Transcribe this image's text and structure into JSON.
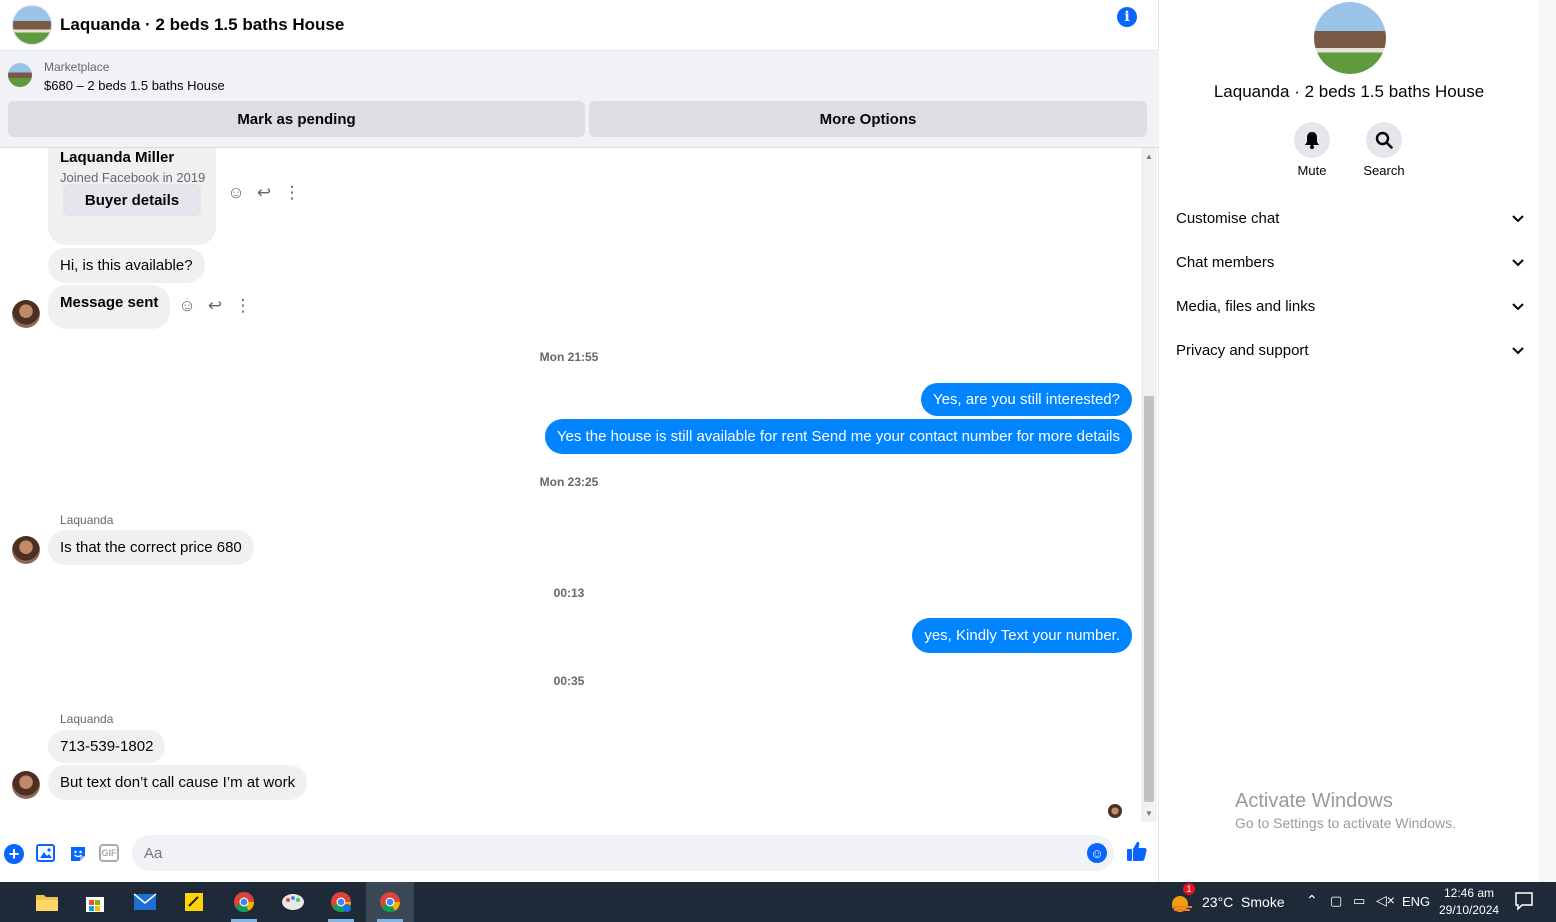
{
  "header": {
    "title": "Laquanda · 2 beds 1.5 baths House",
    "info_icon": "i"
  },
  "marketplace": {
    "label": "Marketplace",
    "item": "$680 – 2 beds 1.5 baths House",
    "mark_pending": "Mark as pending",
    "more_options": "More Options"
  },
  "card": {
    "name": "Laquanda Miller",
    "sub": "Joined Facebook in 2019",
    "button": "Buyer details"
  },
  "messages": {
    "m1": "Hi, is this available?",
    "m2": "Message sent",
    "t1": "Mon 21:55",
    "m3": "Yes, are you still interested?",
    "m4": "Yes the house is still available for rent Send me your contact number for more details",
    "t2": "Mon 23:25",
    "sender": "Laquanda",
    "m5": "Is that the correct price 680",
    "t3": "00:13",
    "m6": "yes, Kindly Text your number.",
    "t4": "00:35",
    "m7": "713-539-1802",
    "m8": "But text don’t call cause I’m at work"
  },
  "composer": {
    "placeholder": "Aa",
    "gif": "GIF"
  },
  "panel": {
    "title": "Laquanda · 2 beds 1.5 baths House",
    "mute": "Mute",
    "search": "Search",
    "sections": [
      "Customise chat",
      "Chat members",
      "Media, files and links",
      "Privacy and support"
    ],
    "activate_title": "Activate Windows",
    "activate_sub": "Go to Settings to activate Windows."
  },
  "taskbar": {
    "weather": "23°C  Smoke",
    "weather_badge": "1",
    "lang": "ENG",
    "time": "12:46 am",
    "date": "29/10/2024"
  },
  "colors": {
    "accent": "#0866ff",
    "outgoing": "#0084ff",
    "incoming": "#f0f0f0"
  }
}
